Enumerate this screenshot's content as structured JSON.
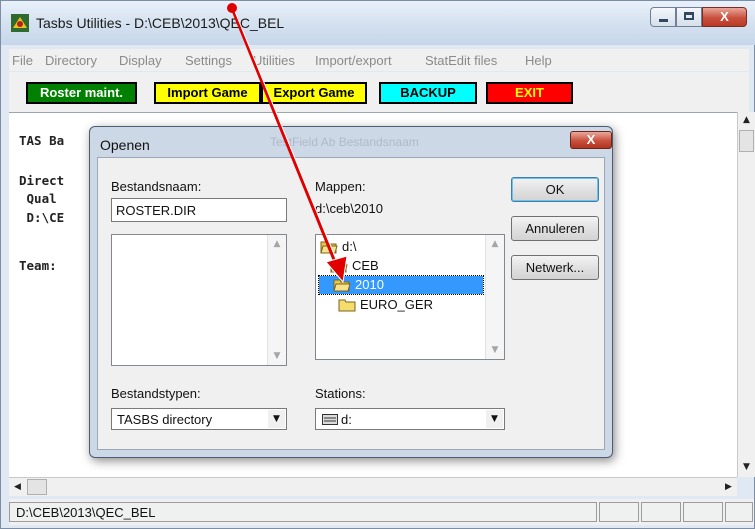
{
  "window": {
    "title": "Tasbs Utilities - D:\\CEB\\2013\\QEC_BEL",
    "close_glyph": "X"
  },
  "menu": [
    "File",
    "Directory",
    "Display",
    "Settings",
    "Utilities",
    "Import/export",
    "StatEdit files",
    "Help"
  ],
  "toolbar": {
    "buttons": [
      {
        "label": "Roster maint.",
        "bg": "#008000",
        "fg": "#ffffff"
      },
      {
        "label": "Import Game",
        "bg": "#ffff00",
        "fg": "#000000"
      },
      {
        "label": "Export Game",
        "bg": "#ffff00",
        "fg": "#000000"
      },
      {
        "label": "BACKUP",
        "bg": "#00ffff",
        "fg": "#000000"
      },
      {
        "label": "EXIT",
        "bg": "#ff0000",
        "fg": "#ffff00"
      }
    ]
  },
  "client_text": {
    "line1": "TAS Ba",
    "line2": "Direct",
    "line3": " Qual",
    "line4": " D:\\CE",
    "line5": "Team:"
  },
  "status": {
    "path": "D:\\CEB\\2013\\QEC_BEL"
  },
  "dialog": {
    "title": "Openen",
    "faded_title": "TestField Ab Bestandsnaam",
    "close_glyph": "X",
    "filename_label": "Bestandsnaam:",
    "filename_value": "ROSTER.DIR",
    "folders_label": "Mappen:",
    "current_path": "d:\\ceb\\2010",
    "folders": [
      {
        "name": "d:\\",
        "selected": false
      },
      {
        "name": "CEB",
        "selected": false
      },
      {
        "name": "2010",
        "selected": true
      },
      {
        "name": "EURO_GER",
        "selected": false
      }
    ],
    "filetypes_label": "Bestandstypen:",
    "filetype_value": "TASBS directory",
    "drives_label": "Stations:",
    "drive_value": "d:",
    "buttons": {
      "ok": "OK",
      "cancel": "Annuleren",
      "network": "Netwerk..."
    }
  },
  "colors": {
    "annotation_arrow": "#e00000",
    "selection": "#3399ff"
  }
}
